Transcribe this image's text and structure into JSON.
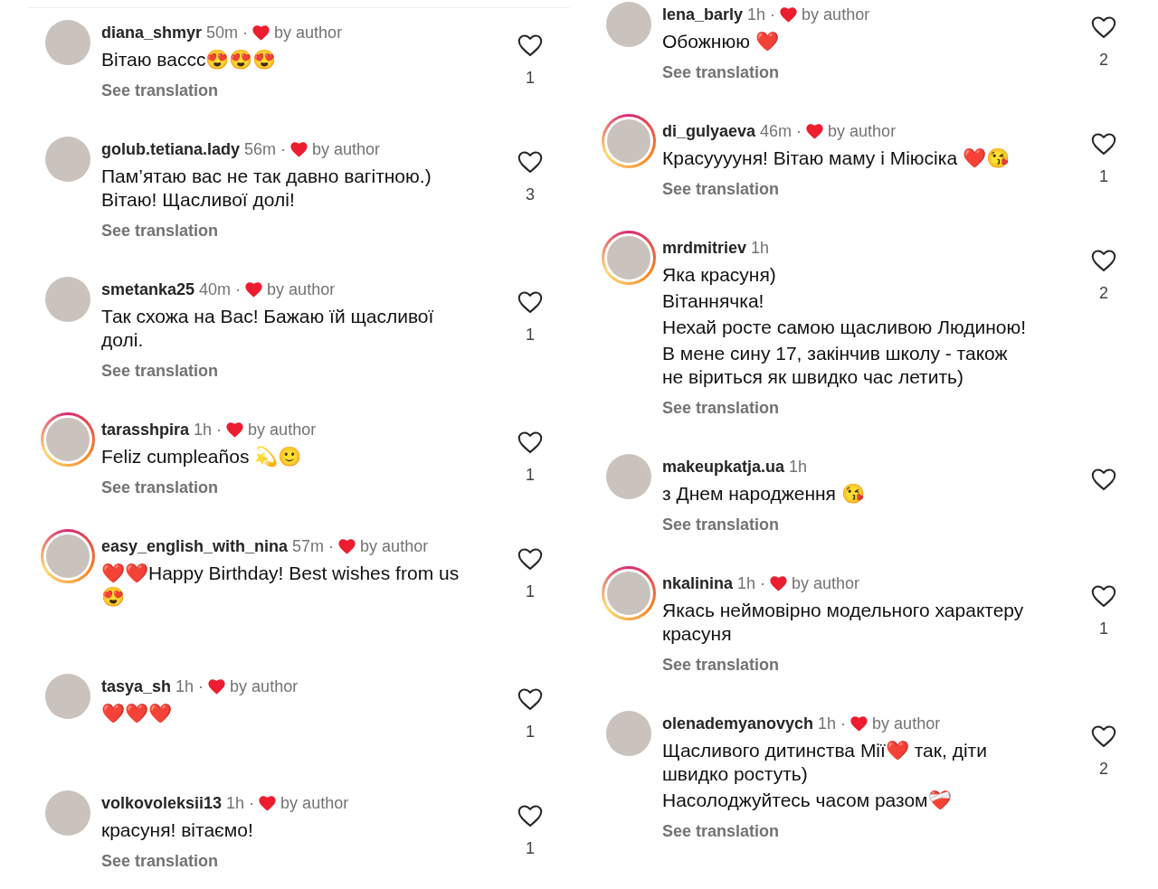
{
  "columns": [
    {
      "comments": [
        {
          "username": "diana_shmyr",
          "time": "50m",
          "separator": "·",
          "liked_by_author": true,
          "author_label": "by author",
          "avatar_ring": false,
          "body": [
            "Вітаю вассс😍😍😍"
          ],
          "see_translation": "See translation",
          "likes": "1"
        },
        {
          "username": "golub.tetiana.lady",
          "time": "56m",
          "separator": "·",
          "liked_by_author": true,
          "author_label": "by author",
          "avatar_ring": false,
          "body": [
            "Пам’ятаю вас не так давно вагітною.) Вітаю! Щасливої долі!"
          ],
          "see_translation": "See translation",
          "likes": "3"
        },
        {
          "username": "smetanka25",
          "time": "40m",
          "separator": "·",
          "liked_by_author": true,
          "author_label": "by author",
          "avatar_ring": false,
          "body": [
            "Так схожа на Вас! Бажаю їй щасливої долі."
          ],
          "see_translation": "See translation",
          "likes": "1"
        },
        {
          "username": "tarasshpira",
          "time": "1h",
          "separator": "·",
          "liked_by_author": true,
          "author_label": "by author",
          "avatar_ring": true,
          "body": [
            "Feliz cumpleaños 💫🙂"
          ],
          "see_translation": "See translation",
          "likes": "1"
        },
        {
          "username": "easy_english_with_nina",
          "time": "57m",
          "separator": "·",
          "liked_by_author": true,
          "author_label": "by author",
          "avatar_ring": true,
          "body": [
            "❤️❤️Happy Birthday! Best wishes from us 😍"
          ],
          "likes": "1"
        },
        {
          "username": "tasya_sh",
          "time": "1h",
          "separator": "·",
          "liked_by_author": true,
          "author_label": "by author",
          "avatar_ring": false,
          "body": [
            "❤️❤️❤️"
          ],
          "likes": "1"
        },
        {
          "username": "volkovoleksii13",
          "time": "1h",
          "separator": "·",
          "liked_by_author": true,
          "author_label": "by author",
          "avatar_ring": false,
          "body": [
            "красуня! вітаємо!"
          ],
          "see_translation": "See translation",
          "likes": "1"
        }
      ]
    },
    {
      "comments": [
        {
          "username": "lena_barly",
          "time": "1h",
          "separator": "·",
          "liked_by_author": true,
          "author_label": "by author",
          "avatar_ring": false,
          "body": [
            "Обожнюю ❤️"
          ],
          "see_translation": "See translation",
          "likes": "2"
        },
        {
          "username": "di_gulyaeva",
          "time": "46m",
          "separator": "·",
          "liked_by_author": true,
          "author_label": "by author",
          "avatar_ring": true,
          "body": [
            "Красууууня! Вітаю маму і Міюсіка ❤️😘"
          ],
          "see_translation": "See translation",
          "likes": "1"
        },
        {
          "username": "mrdmitriev",
          "time": "1h",
          "liked_by_author": false,
          "avatar_ring": true,
          "body": [
            "Яка красуня)",
            "Вітаннячка!",
            "Нехай росте самою щасливою Людиною!",
            "В мене сину 17, закінчив школу - також не віриться як швидко час летить)"
          ],
          "see_translation": "See translation",
          "likes": "2"
        },
        {
          "username": "makeupkatja.ua",
          "time": "1h",
          "liked_by_author": false,
          "avatar_ring": false,
          "body": [
            "з Днем народження 😘"
          ],
          "see_translation": "See translation"
        },
        {
          "username": "nkalinina",
          "time": "1h",
          "separator": "·",
          "liked_by_author": true,
          "author_label": "by author",
          "avatar_ring": true,
          "body": [
            "Якась неймовірно модельного характеру красуня"
          ],
          "see_translation": "See translation",
          "likes": "1"
        },
        {
          "username": "olenademyanovych",
          "time": "1h",
          "separator": "·",
          "liked_by_author": true,
          "author_label": "by author",
          "avatar_ring": false,
          "body": [
            "Щасливого дитинства Мії❤️ так, діти швидко ростуть)",
            "Насолоджуйтесь часом разом❤️‍🩹"
          ],
          "see_translation": "See translation",
          "likes": "2"
        }
      ]
    }
  ]
}
